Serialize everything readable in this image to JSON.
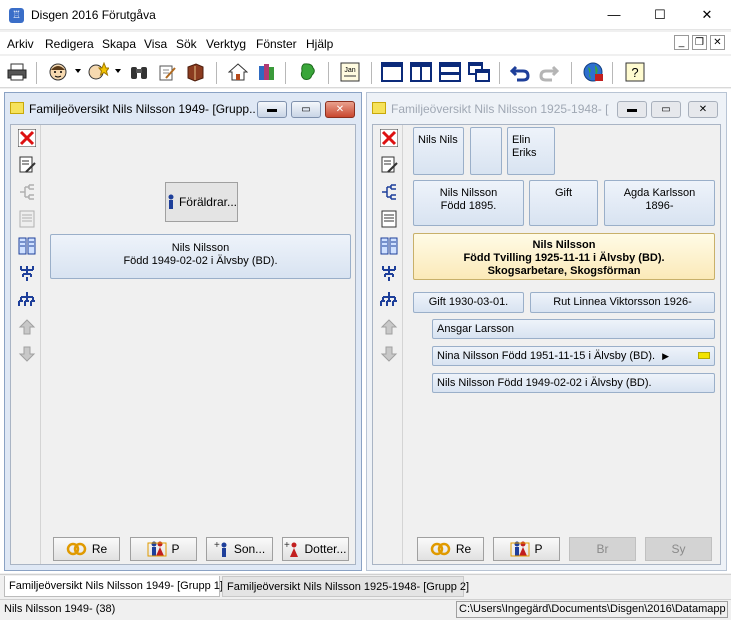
{
  "window": {
    "title": "Disgen 2016 Förutgåva",
    "minimize": "—",
    "maximize": "☐",
    "close": "✕"
  },
  "menu": [
    "Arkiv",
    "Redigera",
    "Skapa",
    "Visa",
    "Sök",
    "Verktyg",
    "Fönster",
    "Hjälp"
  ],
  "mdi_controls": {
    "minimize": "_",
    "restore": "❐",
    "close": "✕"
  },
  "toolbar_icons": [
    "print-icon",
    "person-icon",
    "person-star-icon",
    "binoculars-icon",
    "hand-pen-icon",
    "book-icon",
    "home-icon",
    "books-icon",
    "map-icon",
    "calendar-icon",
    "window-single-icon",
    "window-split-vertical-icon",
    "window-split-horizontal-icon",
    "window-cascade-icon",
    "undo-icon",
    "redo-icon",
    "globe-icon",
    "help-icon"
  ],
  "toolbar_calendar_label": "Jan",
  "toolbar_help_label": "?",
  "left_window": {
    "title": "Familjeöversikt Nils Nilsson 1949- [Grupp 1]",
    "title_shown": "Familjeöversikt Nils Nilsson 1949- [Grupp...",
    "parents_button": "Föräldrar...",
    "person_line1": "Nils Nilsson",
    "person_line2": "Född 1949-02-02 i Älvsby (BD).",
    "buttons": {
      "re": "Re",
      "p": "P",
      "son": "Son...",
      "dotter": "Dotter..."
    }
  },
  "right_window": {
    "title": "Familjeöversikt Nils Nilsson 1925-1948- [Grupp 2]",
    "title_shown": "Familjeöversikt Nils Nilsson 1925-1948- [G...",
    "grandparents": {
      "father_side": "Nils Nils",
      "middle": "",
      "mother_side": "Elin Eriks"
    },
    "father": {
      "name": "Nils Nilsson",
      "born": "Född 1895."
    },
    "marriage_label": "Gift",
    "mother": {
      "name": "Agda Karlsson",
      "years": "1896-"
    },
    "main_person": {
      "name": "Nils Nilsson",
      "born": "Född Tvilling 1925-11-11 i Älvsby (BD).",
      "occupation": "Skogsarbetare, Skogsförman"
    },
    "spouse_marriage": "Gift 1930-03-01.",
    "spouse": "Rut Linnea Viktorsson 1926-",
    "children": [
      {
        "text": "Ansgar Larsson"
      },
      {
        "text": "Nina Nilsson Född 1951-11-15 i Älvsby (BD).",
        "marker": "▶"
      },
      {
        "text": "Nils Nilsson Född 1949-02-02 i Älvsby (BD)."
      }
    ],
    "buttons": {
      "re": "Re",
      "p": "P",
      "br": "Br",
      "sy": "Sy"
    }
  },
  "tabs": [
    {
      "label": "Familjeöversikt Nils Nilsson 1949- [Grupp 1]"
    },
    {
      "label": "Familjeöversikt Nils Nilsson 1925-1948- [Grupp 2]"
    }
  ],
  "status": {
    "left": "Nils Nilsson 1949- (38)",
    "right": "C:\\Users\\Ingegärd\\Documents\\Disgen\\2016\\Datamapp"
  }
}
